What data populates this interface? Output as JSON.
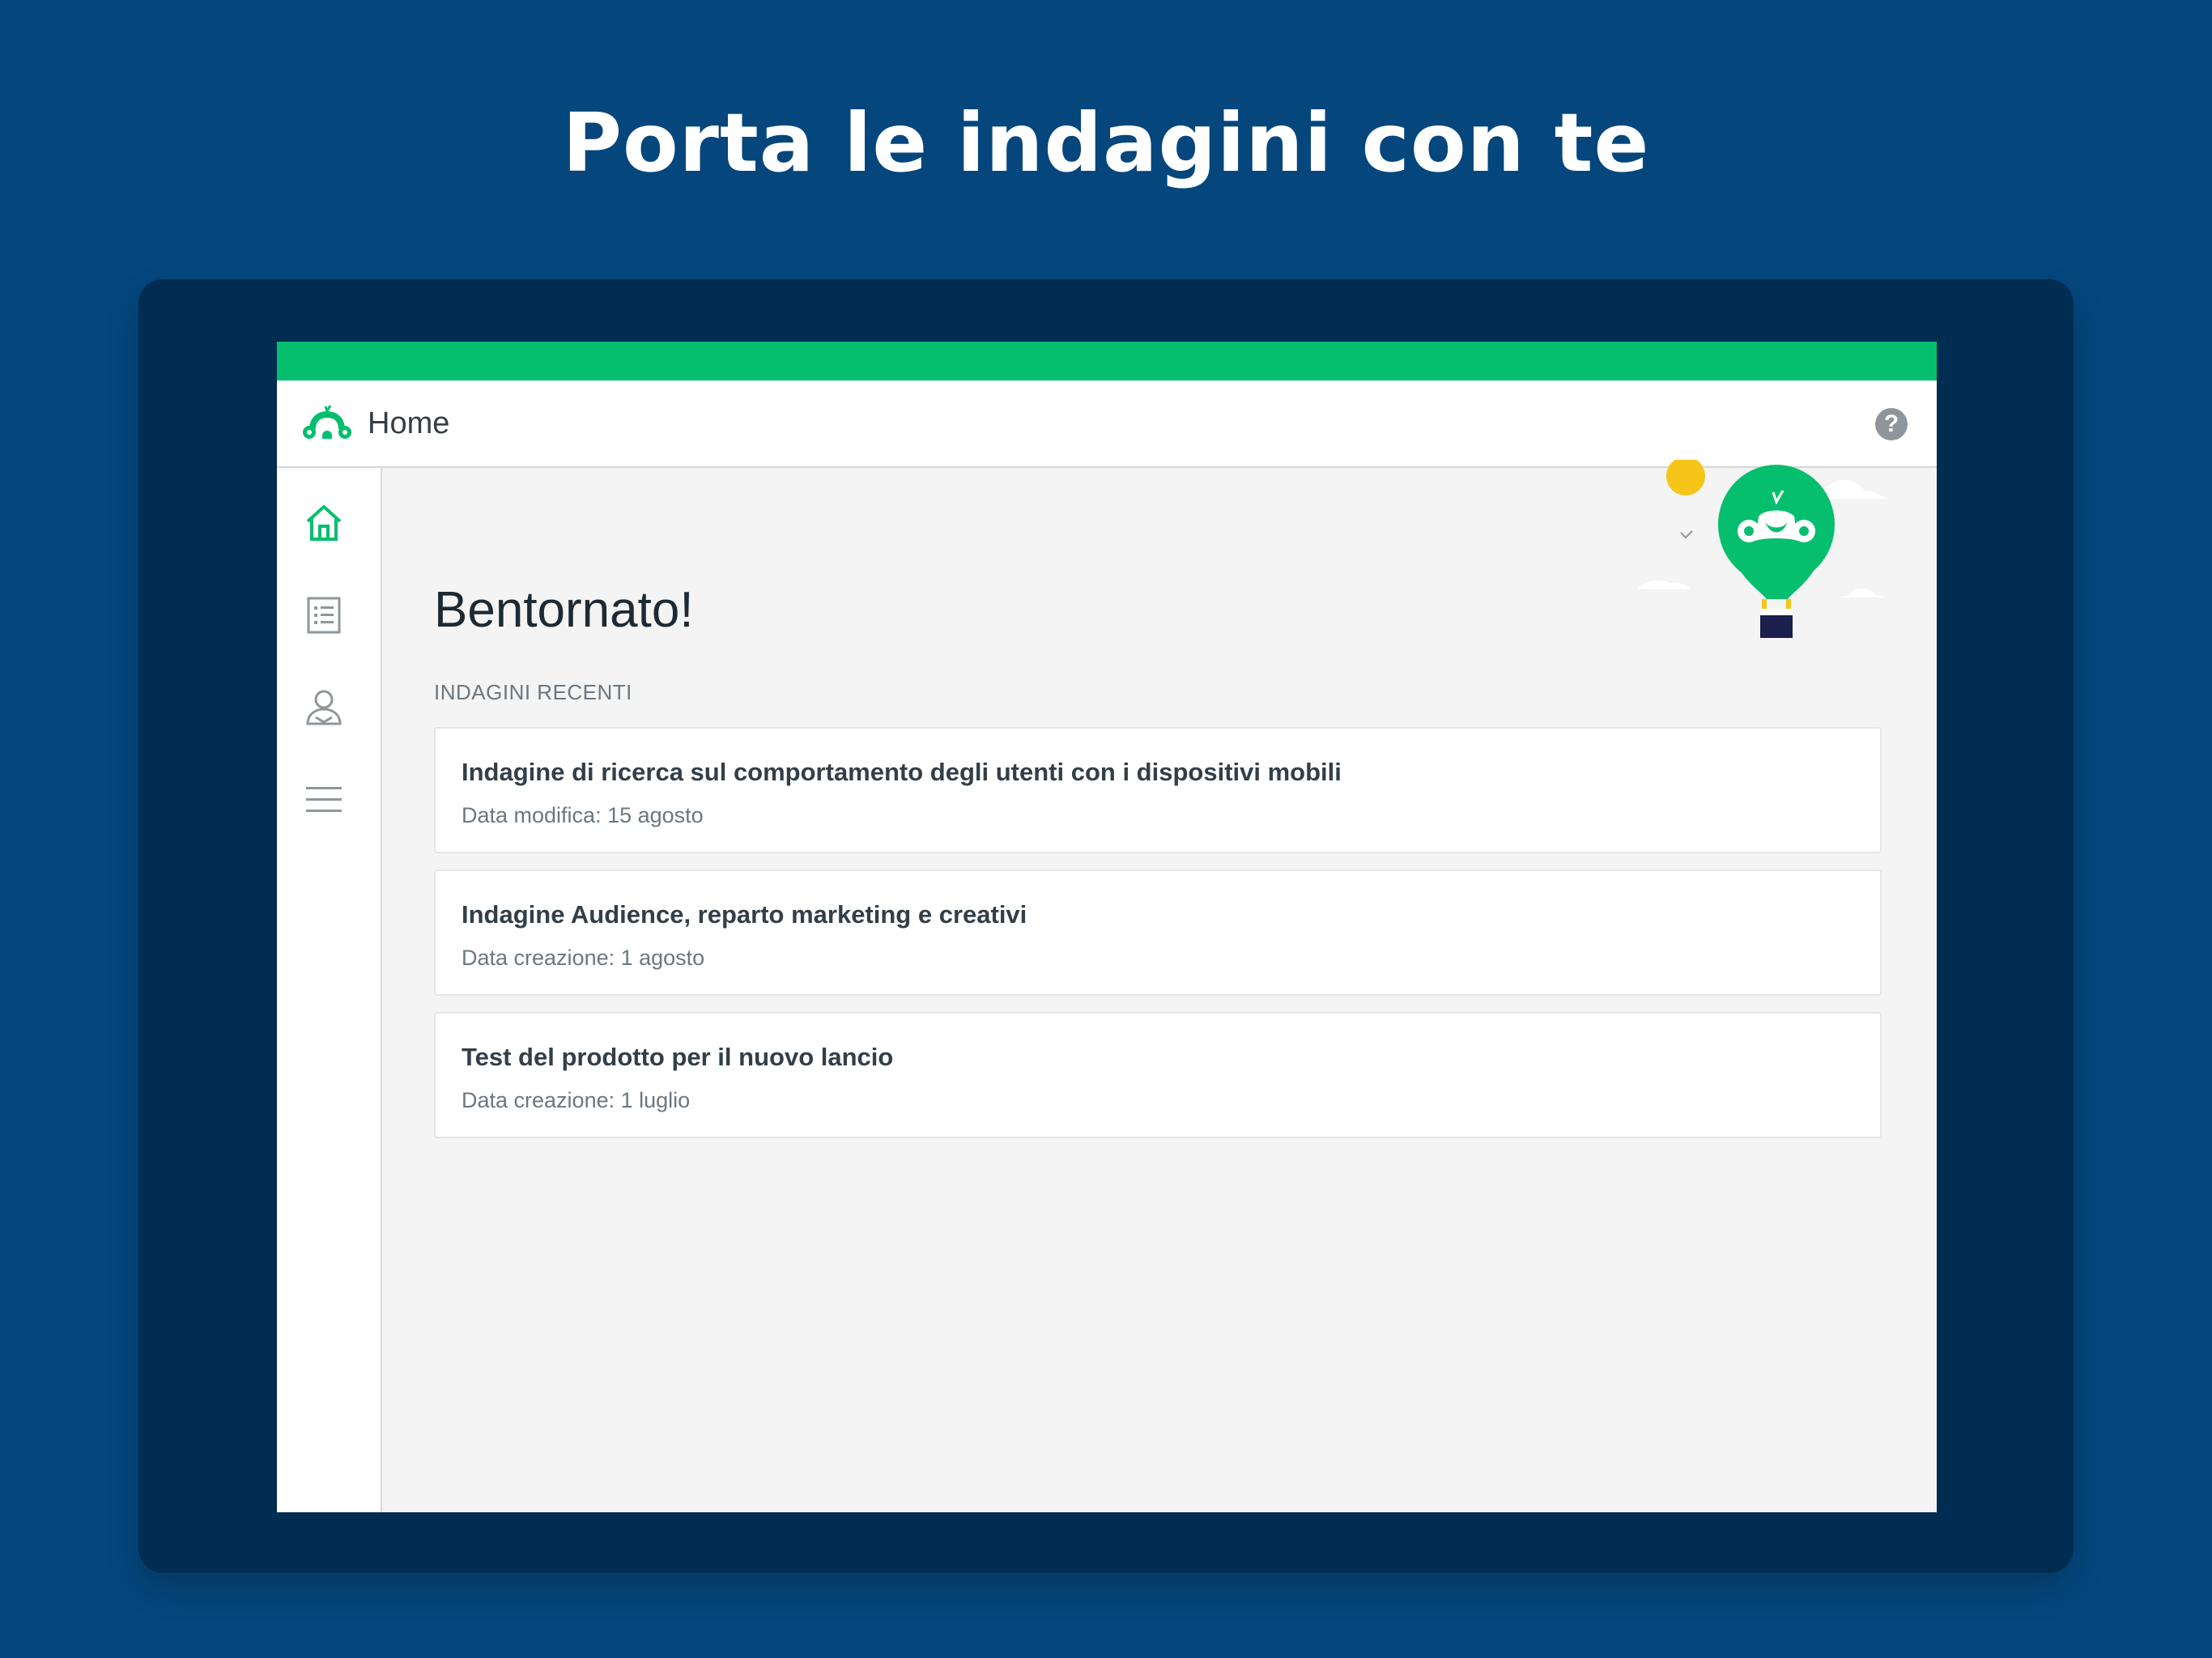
{
  "headline": "Porta le indagini con te",
  "app": {
    "title": "Home",
    "logo_icon": "surveymonkey-logo-icon",
    "help_label": "?"
  },
  "colors": {
    "background": "#05467d",
    "device": "#022d52",
    "accent_green": "#05bf6e",
    "content_bg": "#f4f4f4"
  },
  "sidebar": {
    "items": [
      {
        "id": "home",
        "icon": "home-icon",
        "active": true
      },
      {
        "id": "surveys",
        "icon": "survey-list-icon",
        "active": false
      },
      {
        "id": "account",
        "icon": "user-icon",
        "active": false
      },
      {
        "id": "menu",
        "icon": "hamburger-menu-icon",
        "active": false
      }
    ]
  },
  "main": {
    "welcome": "Bentornato!",
    "section_label": "INDAGINI RECENTI",
    "surveys": [
      {
        "title": "Indagine di ricerca sul comportamento degli utenti con i dispositivi mobili",
        "date": "Data modifica: 15 agosto"
      },
      {
        "title": "Indagine Audience, reparto marketing e creativi",
        "date": "Data creazione: 1 agosto"
      },
      {
        "title": "Test del prodotto per il nuovo lancio",
        "date": "Data creazione: 1 luglio"
      }
    ]
  }
}
